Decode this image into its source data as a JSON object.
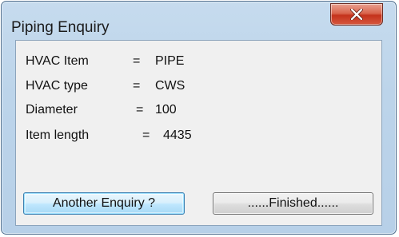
{
  "window": {
    "title": "Piping Enquiry"
  },
  "title_bar": {
    "close_icon": "close-x-icon"
  },
  "info": [
    {
      "label": "HVAC Item",
      "separator": "=",
      "value": "PIPE"
    },
    {
      "label": "HVAC type",
      "separator": "=",
      "value": "CWS"
    },
    {
      "label": "Diameter",
      "separator": "=",
      "value": "100"
    },
    {
      "label": "Item length",
      "separator": "=",
      "value": "4435"
    }
  ],
  "buttons": {
    "another_label": "Another Enquiry ?",
    "finished_label": "......Finished......"
  },
  "colors": {
    "title_bar": "#bcd4ea",
    "close_button": "#c4321c",
    "client_area": "#f0f0f0",
    "focused_button": "#bee6fd"
  }
}
